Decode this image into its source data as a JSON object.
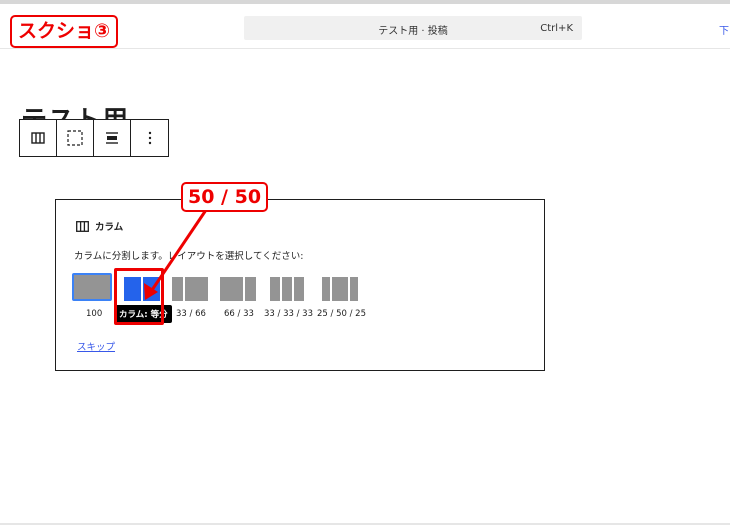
{
  "annotation": {
    "screenshot_tag": "スクショ③",
    "callout": "50 / 50",
    "colors": {
      "annotation_red": "#ee0000"
    }
  },
  "header": {
    "command_palette_title": "テスト用 · 投稿",
    "shortcut": "Ctrl+K",
    "right_link": "下"
  },
  "editor": {
    "post_title": "テスト用"
  },
  "toolbar": {
    "items": [
      {
        "icon": "columns-icon"
      },
      {
        "icon": "select-parent-icon"
      },
      {
        "icon": "align-icon"
      },
      {
        "icon": "more-options-icon"
      }
    ]
  },
  "columns_block": {
    "label": "カラム",
    "instructions": "カラムに分割します。レイアウトを選択してください:",
    "variations": [
      {
        "label": "100",
        "widths": [
          100
        ]
      },
      {
        "label": "50 / 50",
        "widths": [
          50,
          50
        ]
      },
      {
        "label": "33 / 66",
        "widths": [
          33,
          66
        ]
      },
      {
        "label": "66 / 33",
        "widths": [
          66,
          33
        ]
      },
      {
        "label": "33 / 33 / 33",
        "widths": [
          33,
          33,
          33
        ]
      },
      {
        "label": "25 / 50 / 25",
        "widths": [
          25,
          50,
          25
        ]
      }
    ],
    "tooltip": "カラム: 等分",
    "skip_label": "スキップ",
    "colors": {
      "selected_border": "#3b82f6",
      "hover_fill": "#2463eb",
      "default_fill": "#949494"
    }
  }
}
